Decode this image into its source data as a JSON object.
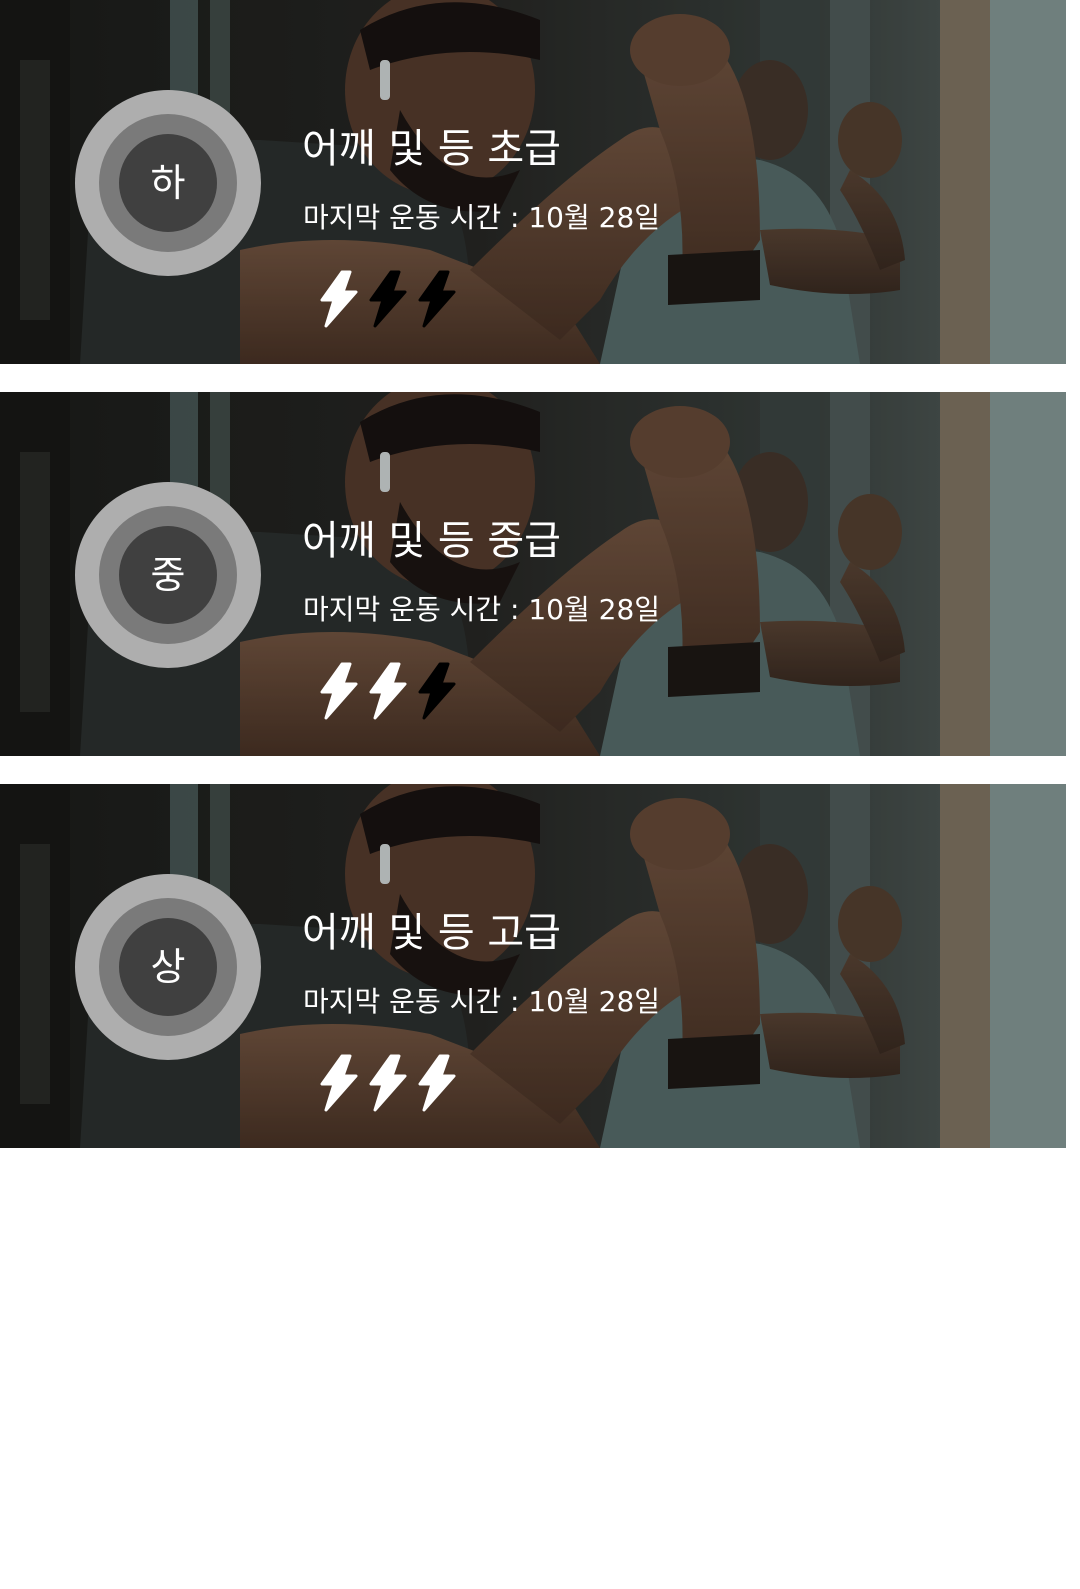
{
  "colors": {
    "badge_outer": "#aeaeae",
    "badge_mid": "#7a7a7a",
    "badge_core": "#404040",
    "bolt_on": "#ffffff",
    "bolt_off": "#000000",
    "background": "#ffffff"
  },
  "workouts": [
    {
      "level": "하",
      "title": "어깨 및 등 초급",
      "last_workout": "마지막 운동 시간 : 10월 28일",
      "intensity": 1,
      "intensity_max": 3,
      "icon": "lightning-bolt-icon"
    },
    {
      "level": "중",
      "title": "어깨 및 등 중급",
      "last_workout": "마지막 운동 시간 : 10월 28일",
      "intensity": 2,
      "intensity_max": 3,
      "icon": "lightning-bolt-icon"
    },
    {
      "level": "상",
      "title": "어깨 및 등 고급",
      "last_workout": "마지막 운동 시간 : 10월 28일",
      "intensity": 3,
      "intensity_max": 3,
      "icon": "lightning-bolt-icon"
    }
  ]
}
